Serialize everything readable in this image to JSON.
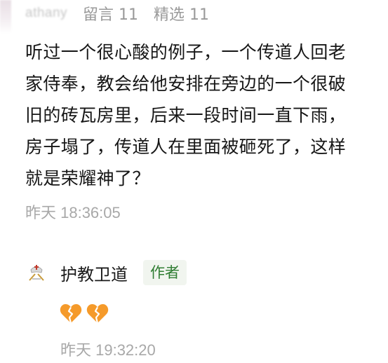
{
  "comment": {
    "username": "athany",
    "reply_count": "留言 11",
    "featured_count": "精选 11",
    "text_lines": [
      "听过一个很心酸的例子，一个传道人回老",
      "家侍奉，教会给他安排在旁边的一个很破",
      "旧的砖瓦房里，后来一段时间一直下雨，",
      "房子塌了，传道人在里面被砸死了，这样",
      "就是荣耀神了？"
    ],
    "time": "昨天 18:36:05"
  },
  "reply": {
    "name": "护教卫道",
    "badge": "作者",
    "emoji": [
      "broken-heart",
      "broken-heart"
    ],
    "time": "昨天 19:32:20"
  },
  "colors": {
    "badge_bg": "#f1f5ef",
    "badge_text": "#2f7d32",
    "meta_gray": "#9a9a9a",
    "time_gray": "#a8a8a8",
    "heart_orange": "#f59a2a"
  }
}
